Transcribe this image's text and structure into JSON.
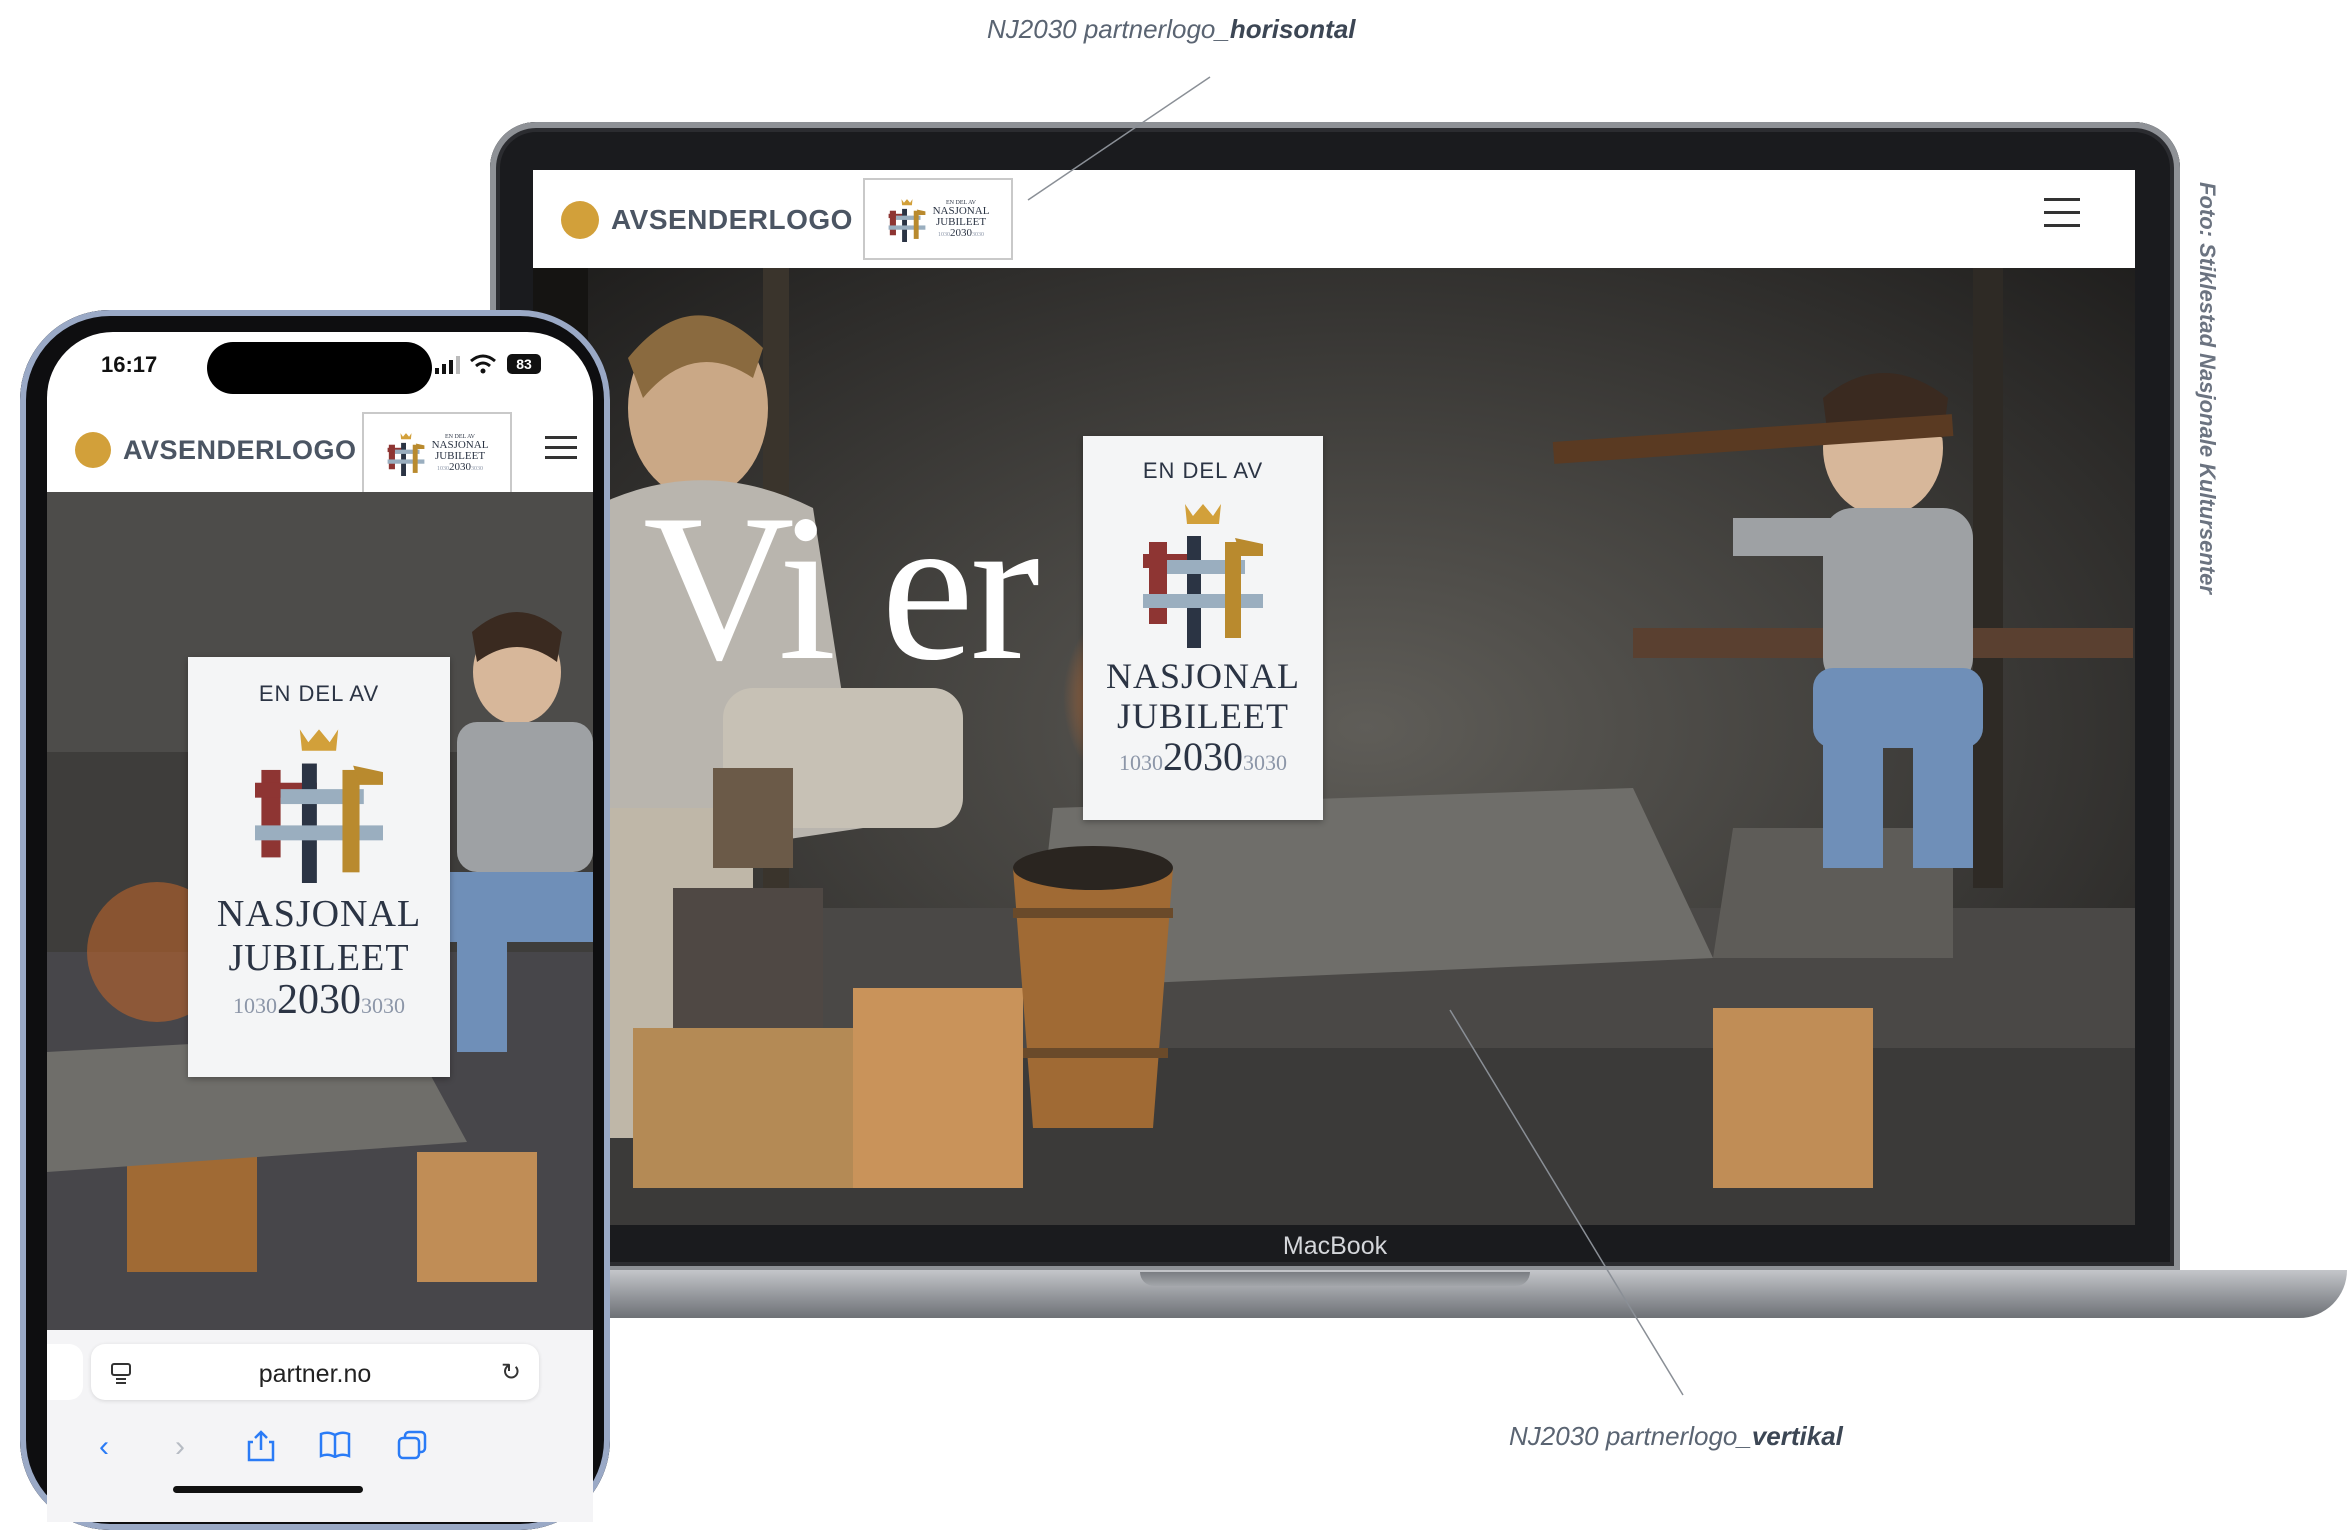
{
  "annotations": {
    "top_prefix": "NJ2030 partnerlogo_",
    "top_bold": "horisontal",
    "bottom_prefix": "NJ2030 partnerlogo_",
    "bottom_bold": "vertikal",
    "photo_credit": "Foto: Stiklestad Nasjonale Kultursenter"
  },
  "laptop": {
    "brand_label": "MacBook",
    "header": {
      "sender_logo": "AVSENDERLOGO"
    },
    "hero_text": "Vi er"
  },
  "partner_logo": {
    "small_top": "EN DEL AV",
    "small_line1": "NASJONAL",
    "small_line2": "JUBILEET",
    "small_year_left": "1030",
    "small_year_main": "2030",
    "small_year_right": "3030",
    "card_top": "EN DEL AV",
    "card_line1": "NASJONAL",
    "card_line2": "JUBILEET",
    "year_left": "1030",
    "year_main": "2030",
    "year_right": "3030",
    "colors": {
      "red": "#8e3533",
      "navy": "#2b3444",
      "blue": "#9aaebf",
      "gold": "#b98a2e"
    }
  },
  "phone": {
    "status": {
      "time": "16:17",
      "battery": "83"
    },
    "header": {
      "sender_logo": "AVSENDERLOGO"
    },
    "url": "partner.no",
    "toolbar": [
      "back-icon",
      "forward-icon",
      "share-icon",
      "bookmarks-icon",
      "tabs-icon"
    ]
  }
}
